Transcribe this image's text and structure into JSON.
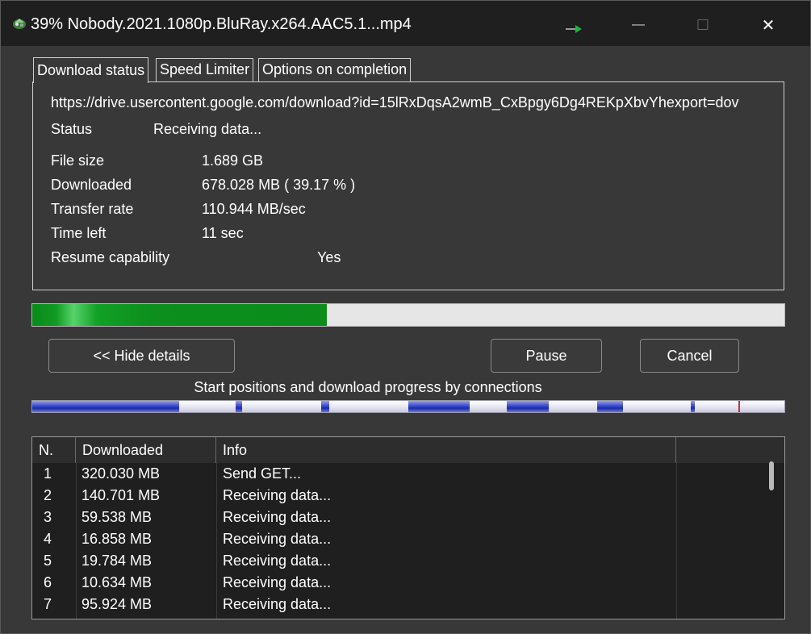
{
  "window": {
    "title": "39% Nobody.2021.1080p.BluRay.x264.AAC5.1...mp4",
    "min_glyph": "—",
    "max_glyph": "☐",
    "close_glyph": "✕"
  },
  "tabs": [
    {
      "label": "Download status"
    },
    {
      "label": "Speed Limiter"
    },
    {
      "label": "Options on completion"
    }
  ],
  "status": {
    "url": "https://drive.usercontent.google.com/download?id=15lRxDqsA2wmB_CxBpgy6Dg4REKpXbvYhexport=dov",
    "status_label": "Status",
    "status_value": "Receiving data...",
    "file_size_label": "File size",
    "file_size_value": "1.689  GB",
    "downloaded_label": "Downloaded",
    "downloaded_value": "678.028  MB  ( 39.17 % )",
    "transfer_rate_label": "Transfer rate",
    "transfer_rate_value": "110.944  MB/sec",
    "time_left_label": "Time left",
    "time_left_value": "11 sec",
    "resume_label": "Resume capability",
    "resume_value": "Yes"
  },
  "progress": {
    "fraction": 0.3917,
    "color": "#0b8c1b"
  },
  "buttons": {
    "hide_details": "<< Hide details",
    "pause": "Pause",
    "cancel": "Cancel"
  },
  "connections": {
    "caption": "Start positions and download progress by connections"
  },
  "table": {
    "headers": [
      "N.",
      "Downloaded",
      "Info"
    ],
    "rows": [
      {
        "n": "1",
        "downloaded": "320.030  MB",
        "info": "Send GET..."
      },
      {
        "n": "2",
        "downloaded": "140.701  MB",
        "info": "Receiving data..."
      },
      {
        "n": "3",
        "downloaded": "59.538  MB",
        "info": "Receiving data..."
      },
      {
        "n": "4",
        "downloaded": "16.858  MB",
        "info": "Receiving data..."
      },
      {
        "n": "5",
        "downloaded": "19.784  MB",
        "info": "Receiving data..."
      },
      {
        "n": "6",
        "downloaded": "10.634  MB",
        "info": "Receiving data..."
      },
      {
        "n": "7",
        "downloaded": "95.924  MB",
        "info": "Receiving data..."
      }
    ]
  }
}
